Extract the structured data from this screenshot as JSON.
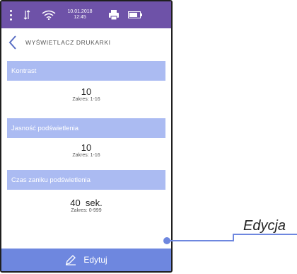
{
  "status_bar": {
    "date": "10.01.2018",
    "time": "12:45",
    "icons": [
      "more-vert-icon",
      "data-arrows-icon",
      "wifi-icon",
      "printer-icon",
      "battery-icon"
    ]
  },
  "header": {
    "title": "WYŚWIETLACZ DRUKARKI"
  },
  "settings": [
    {
      "label": "Kontrast",
      "value": "10",
      "range": "Zakres: 1-16"
    },
    {
      "label": "Jasność podświetlenia",
      "value": "10",
      "range": "Zakres: 1-16"
    },
    {
      "label": "Czas zaniku podświetlenia",
      "value": "40  sek.",
      "range": "Zakres: 0-999"
    }
  ],
  "bottom_bar": {
    "label": "Edytuj"
  },
  "callout": {
    "text": "Edycja"
  },
  "colors": {
    "status_bar": "#6e52a8",
    "section_header": "#abbbf2",
    "bottom_bar": "#6e87df",
    "callout": "#6e87df"
  }
}
